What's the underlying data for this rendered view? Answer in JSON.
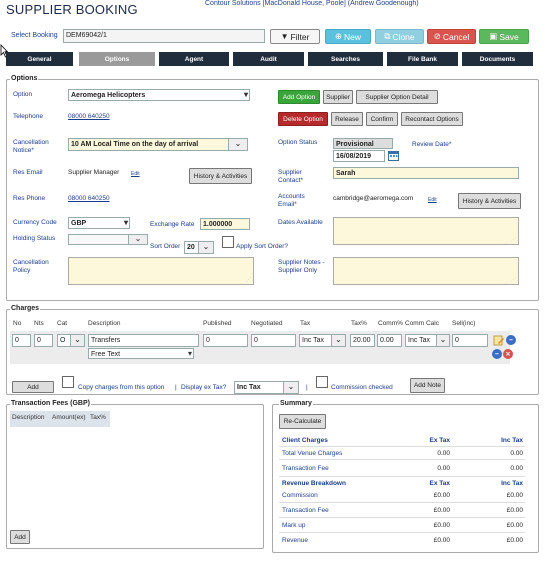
{
  "page": {
    "title": "SUPPLIER BOOKING",
    "subtitle": "Contour Solutions [MacDonald House, Poole] (Andrew Goodenough)"
  },
  "toolbar": {
    "select_booking_label": "Select Booking",
    "booking_value": "DEM69042/1",
    "filter": "Filter",
    "new": "New",
    "clone": "Clone",
    "cancel": "Cancel",
    "save": "Save"
  },
  "tabs": [
    "General",
    "Options",
    "Agent",
    "Audit",
    "Searches",
    "File Bank",
    "Documents"
  ],
  "active_tab": "Options",
  "options": {
    "legend": "Options",
    "option_label": "Option",
    "option_value": "Aeromega Helicopters",
    "telephone_label": "Telephone",
    "telephone_value": "08000 640250",
    "cancellation_notice_label": "Cancellation Notice*",
    "cancellation_notice_value": "10 AM Local Time on the day of arrival",
    "res_email_label": "Res Email",
    "res_email_value": "Supplier Manager",
    "res_email_edit": "Edit",
    "res_phone_label": "Res Phone",
    "res_phone_value": "08000 640250",
    "currency_code_label": "Currency Code",
    "currency_code_value": "GBP",
    "exchange_rate_label": "Exchange Rate",
    "exchange_rate_value": "1.000000",
    "holding_status_label": "Holding Status",
    "sort_order_label": "Sort Order",
    "sort_order_value": "20",
    "apply_sort_order_label": "Apply Sort Order?",
    "cancellation_policy_label": "Cancellation Policy",
    "option_status_label": "Option Status",
    "option_status_value": "Provisional",
    "option_date_value": "16/08/2019",
    "review_date_label": "Review Date*",
    "supplier_contact_label": "Supplier Contact*",
    "supplier_contact_value": "Sarah",
    "accounts_email_label": "Accounts Email*",
    "accounts_email_value": "cambridge@aeromega.com",
    "accounts_email_edit": "Edit",
    "dates_available_label": "Dates Available",
    "supplier_notes_label": "Supplier Notes - Supplier Only",
    "buttons": {
      "add_option": "Add Option",
      "supplier": "Supplier",
      "supplier_option_detail": "Supplier Option Detail",
      "delete_option": "Delete Option",
      "release": "Release",
      "confirm": "Confirm",
      "recontact_options": "Recontact Options",
      "history_activities_1": "History & Activities",
      "history_activities_2": "History & Activities"
    }
  },
  "charges": {
    "legend": "Charges",
    "headers": [
      "No",
      "Nts",
      "Cat",
      "Description",
      "Published",
      "Negotiated",
      "Tax",
      "Tax%",
      "Comm%",
      "Comm Calc",
      "Sell(inc)"
    ],
    "row": {
      "no": "0",
      "nts": "0",
      "cat": "O",
      "description": "Transfers",
      "description_type": "Free Text",
      "published": "0",
      "negotiated": "0",
      "tax": "Inc Tax",
      "tax_pct": "20.00",
      "comm_pct": "0.00",
      "comm_calc": "Inc Tax",
      "sell_inc": "0"
    },
    "add": "Add",
    "copy_charges_label": "Copy charges from this option",
    "display_ex_tax_label": "Display ex Tax?",
    "display_ex_tax_value": "Inc Tax",
    "commission_checked_label": "Commission checked",
    "add_note": "Add Note"
  },
  "transaction_fees": {
    "legend": "Transaction Fees (GBP)",
    "headers": [
      "Description",
      "Amount(ex)",
      "Tax%"
    ],
    "add": "Add"
  },
  "summary": {
    "legend": "Summary",
    "recalculate": "Re-Calculate",
    "client_charges": {
      "title": "Client Charges",
      "col1": "Ex Tax",
      "col2": "Inc Tax",
      "rows": [
        {
          "label": "Total Venue Charges",
          "ex": "0.00",
          "inc": "0.00"
        },
        {
          "label": "Transaction Fee",
          "ex": "0.00",
          "inc": "0.00"
        }
      ]
    },
    "revenue_breakdown": {
      "title": "Revenue Breakdown",
      "col1": "Ex Tax",
      "col2": "Inc Tax",
      "rows": [
        {
          "label": "Commission",
          "ex": "£0.00",
          "inc": "£0.00"
        },
        {
          "label": "Transaction Fee",
          "ex": "£0.00",
          "inc": "£0.00"
        },
        {
          "label": "Mark up",
          "ex": "£0.00",
          "inc": "£0.00"
        },
        {
          "label": "Revenue",
          "ex": "£0.00",
          "inc": "£0.00"
        }
      ]
    }
  },
  "colors": {
    "tab_dark": "#1f2d3d",
    "tab_active": "#9a9a9a",
    "new_btn": "#5bc0de",
    "clone_btn": "#8fcfe0",
    "cancel_btn": "#d9534f",
    "save_btn": "#5cb85c",
    "add_option_btn": "#3aa53a",
    "delete_option_btn": "#b52a2a",
    "input_yellow": "#fdf8dc"
  }
}
